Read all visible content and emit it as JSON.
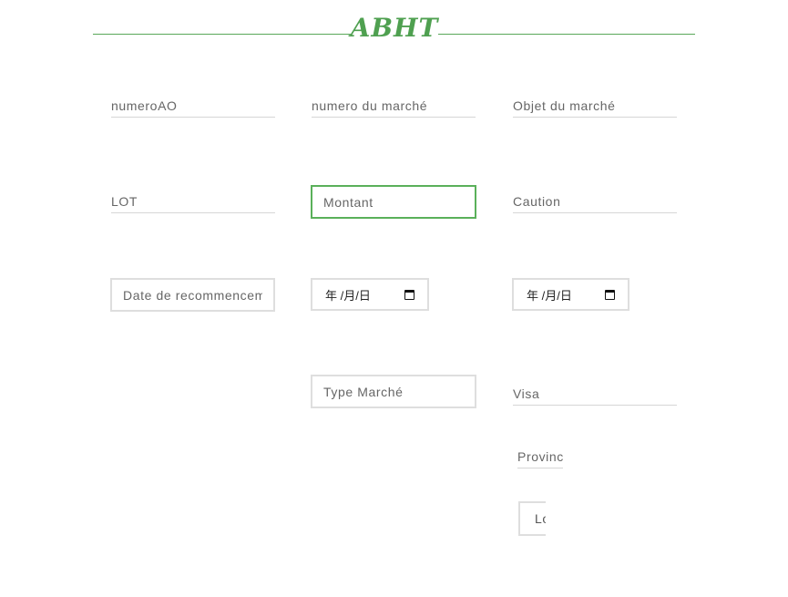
{
  "header": {
    "brand": "ABHT"
  },
  "form": {
    "numero_ao": {
      "placeholder": "numeroAO"
    },
    "numero_marche": {
      "placeholder": "numero du marché"
    },
    "objet_marche": {
      "placeholder": "Objet du marché"
    },
    "lot": {
      "placeholder": "LOT"
    },
    "montant": {
      "placeholder": "Montant"
    },
    "caution": {
      "placeholder": "Caution"
    },
    "date_recommencement": {
      "placeholder": "Date de recommencem"
    },
    "date_1": {
      "display": "年 /月/日"
    },
    "date_2": {
      "display": "年 /月/日"
    },
    "type_marche": {
      "placeholder": "Type Marché"
    },
    "visa": {
      "placeholder": "Visa"
    },
    "province": {
      "placeholder": "Provinc"
    },
    "clipped_field": {
      "text": "Lo"
    }
  },
  "colors": {
    "accent": "#5aa85a",
    "border": "#dedede"
  }
}
